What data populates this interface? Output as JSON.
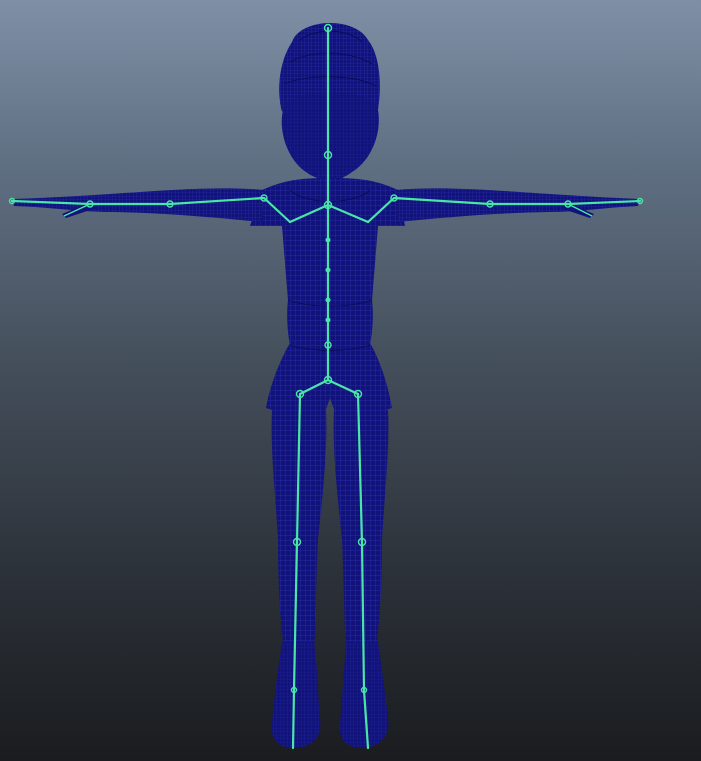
{
  "viewport": {
    "view": "front-orthographic",
    "display_mode": "wireframe",
    "background_top": "#7f8fa5",
    "background_bottom": "#1a1c1f"
  },
  "colors": {
    "mesh": "#12137a",
    "wire": "#2a2ea8",
    "skeleton": "#49e6a8"
  },
  "model": {
    "pose": "T-pose",
    "icon": "character-rig-icon"
  }
}
